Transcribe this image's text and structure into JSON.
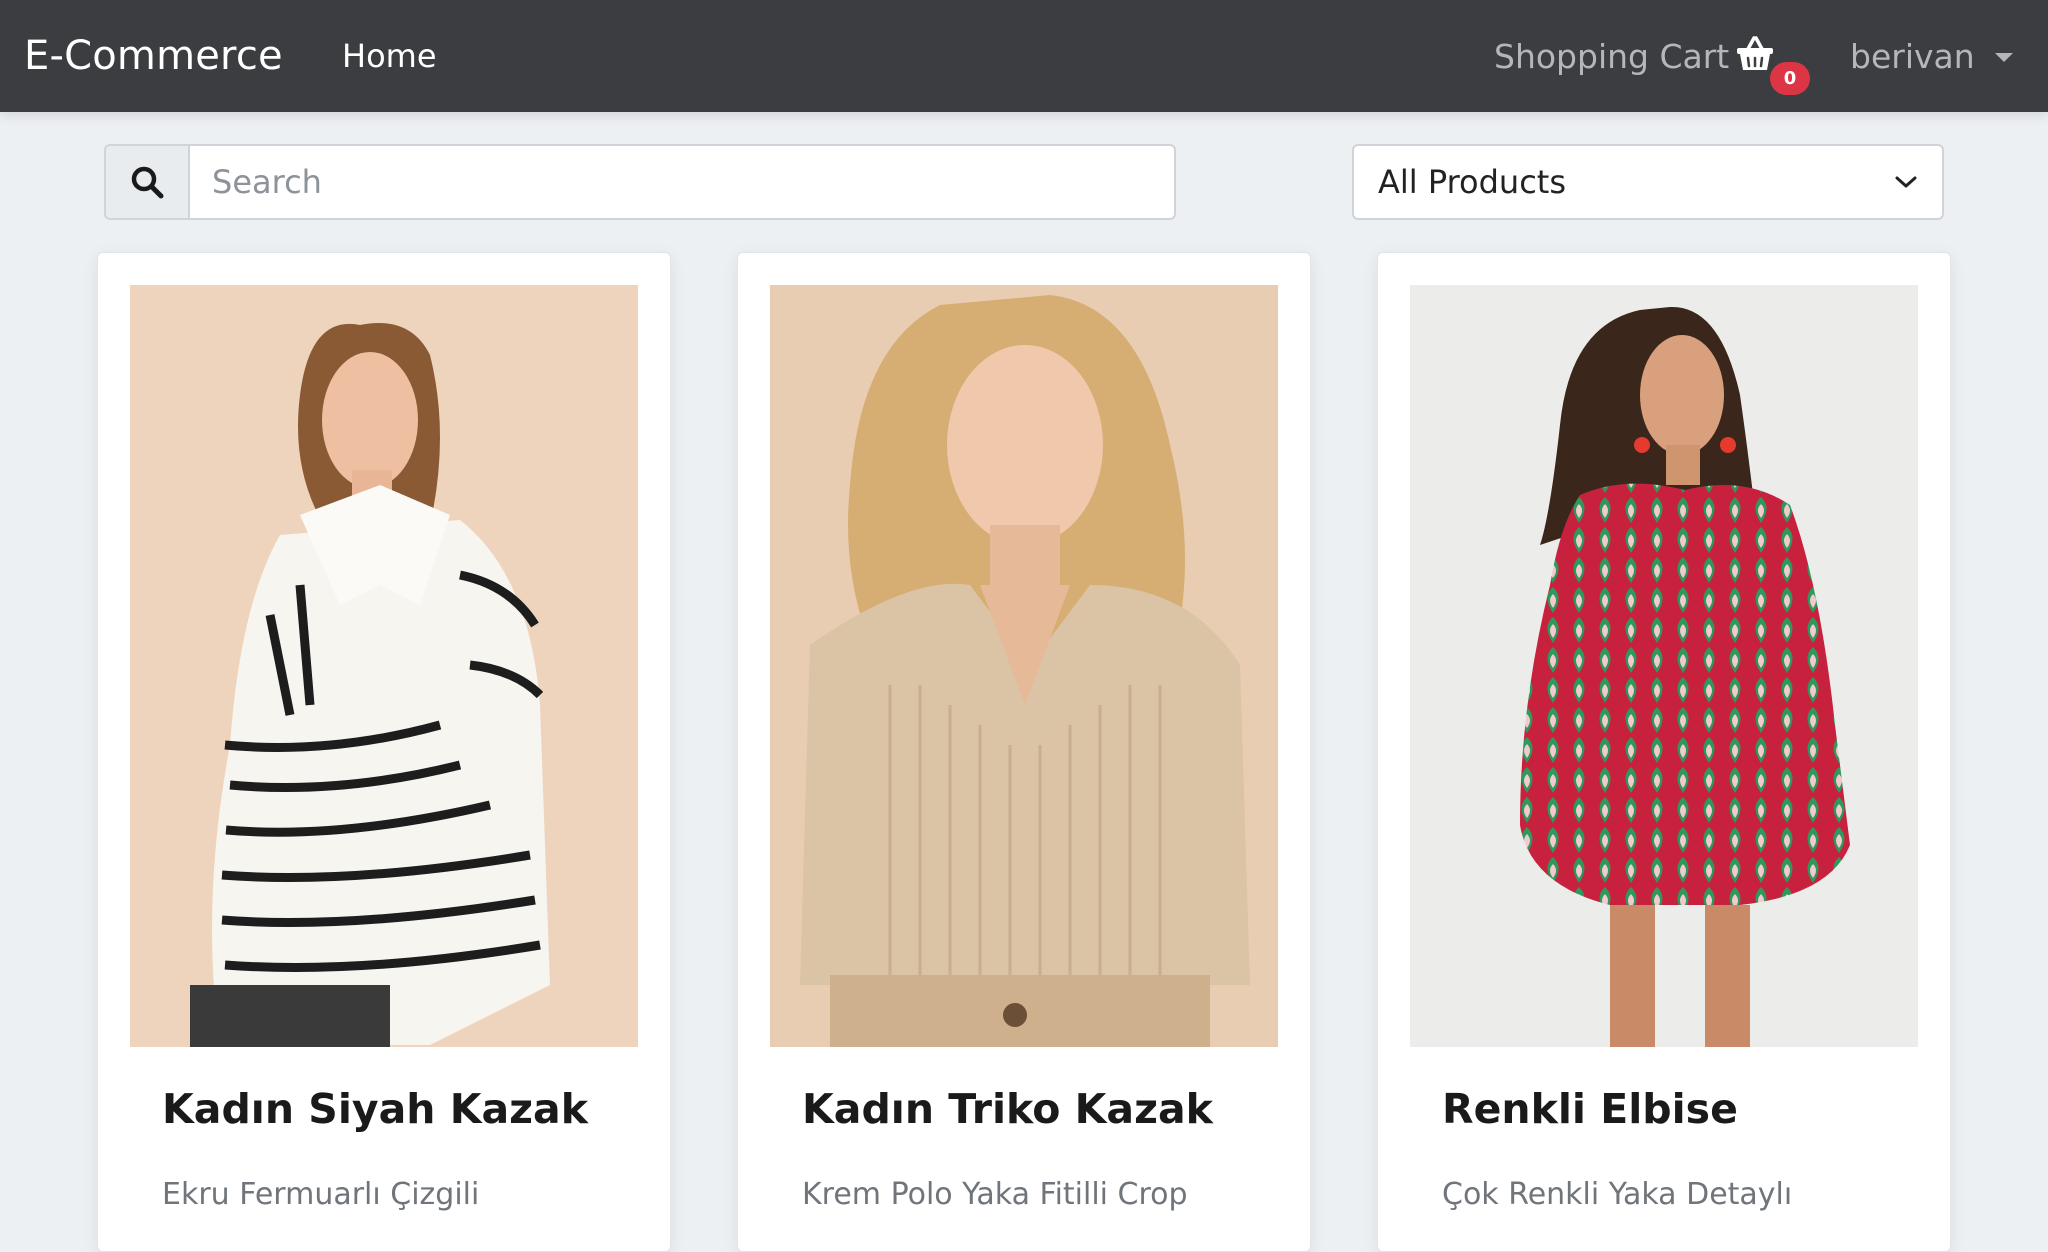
{
  "navbar": {
    "brand": "E-Commerce",
    "home_label": "Home",
    "cart_label": "Shopping Cart",
    "cart_icon": "basket-icon",
    "cart_count": "0",
    "user_name": "berivan",
    "user_caret_icon": "caret-down-icon",
    "background": "#3b3d40",
    "badge_color": "#dc3545"
  },
  "filters": {
    "search_icon": "search-icon",
    "search_placeholder": "Search",
    "search_value": "",
    "category_selected": "All Products",
    "category_icon": "chevron-down-icon"
  },
  "products": [
    {
      "title": "Kadın Siyah Kazak",
      "description": "Ekru Fermuarlı Çizgili",
      "image": "model wearing white sweater with black stripes"
    },
    {
      "title": "Kadın Triko Kazak",
      "description": "Krem Polo Yaka Fitilli Crop",
      "image": "model wearing beige ribbed knit polo sweater"
    },
    {
      "title": "Renkli Elbise",
      "description": "Çok Renkli Yaka Detaylı",
      "image": "model wearing red and green patterned dress"
    }
  ]
}
